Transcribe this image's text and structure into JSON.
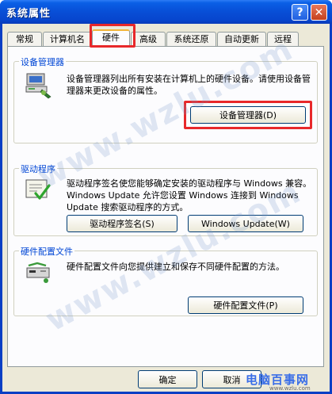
{
  "window": {
    "title": "系统属性",
    "help_glyph": "?",
    "close_glyph": "✕"
  },
  "tabs": [
    {
      "label": "常规"
    },
    {
      "label": "计算机名"
    },
    {
      "label": "硬件",
      "active": true
    },
    {
      "label": "高级"
    },
    {
      "label": "系统还原"
    },
    {
      "label": "自动更新"
    },
    {
      "label": "远程"
    }
  ],
  "device_manager": {
    "title": "设备管理器",
    "description": "设备管理器列出所有安装在计算机上的硬件设备。请使用设备管理器来更改设备的属性。",
    "button_label": "设备管理器(D)",
    "icon": "device-manager-icon"
  },
  "drivers": {
    "title": "驱动程序",
    "description": "驱动程序签名使您能够确定安装的驱动程序与 Windows 兼容。Windows Update 允许您设置 Windows 连接到 Windows Update 搜索驱动程序的方式。",
    "signing_button_label": "驱动程序签名(S)",
    "update_button_label": "Windows Update(W)",
    "icon": "driver-signing-icon"
  },
  "hardware_profiles": {
    "title": "硬件配置文件",
    "description": "硬件配置文件向您提供建立和保存不同硬件配置的方法。",
    "button_label": "硬件配置文件(P)",
    "icon": "hardware-profile-icon"
  },
  "dialog_buttons": {
    "ok_label": "确定",
    "cancel_label": "取消"
  },
  "watermark": {
    "text": "www.wzlu.com",
    "brand": "电脑百事网",
    "brand_sub": "www.wzlu.com"
  },
  "colors": {
    "titlebar": "#0850d8",
    "group_title": "#0046d5",
    "highlight": "#e8282a"
  }
}
